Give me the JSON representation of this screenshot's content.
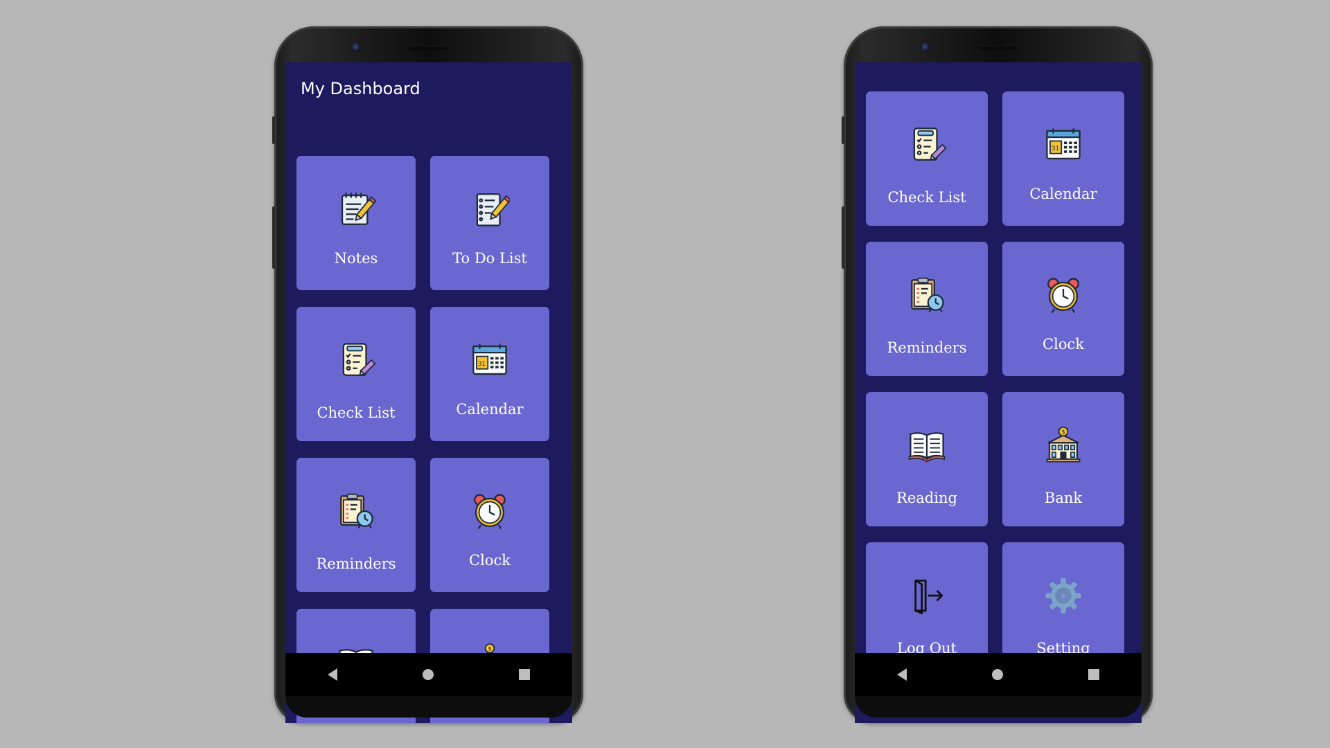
{
  "left_phone": {
    "app_title": "My Dashboard",
    "cards": [
      {
        "label": "Notes",
        "icon": "notes-icon"
      },
      {
        "label": "To Do List",
        "icon": "todo-list-icon"
      },
      {
        "label": "Check List",
        "icon": "checklist-icon"
      },
      {
        "label": "Calendar",
        "icon": "calendar-icon"
      },
      {
        "label": "Reminders",
        "icon": "reminders-icon"
      },
      {
        "label": "Clock",
        "icon": "clock-icon"
      },
      {
        "label": "",
        "icon": "reading-icon"
      },
      {
        "label": "",
        "icon": "bank-icon"
      }
    ]
  },
  "right_phone": {
    "cards": [
      {
        "label": "Check List",
        "icon": "checklist-icon"
      },
      {
        "label": "Calendar",
        "icon": "calendar-icon"
      },
      {
        "label": "Reminders",
        "icon": "reminders-icon"
      },
      {
        "label": "Clock",
        "icon": "clock-icon"
      },
      {
        "label": "Reading",
        "icon": "reading-icon"
      },
      {
        "label": "Bank",
        "icon": "bank-icon"
      },
      {
        "label": "Log Out",
        "icon": "logout-icon"
      },
      {
        "label": "Setting",
        "icon": "gear-icon"
      }
    ]
  },
  "nav": {
    "back": "back-icon",
    "home": "home-icon",
    "recent": "recent-apps-icon"
  },
  "colors": {
    "background": "#b7b7b7",
    "screen": "#1e1a5e",
    "card": "#6a67d1",
    "text": "#ffffff"
  }
}
